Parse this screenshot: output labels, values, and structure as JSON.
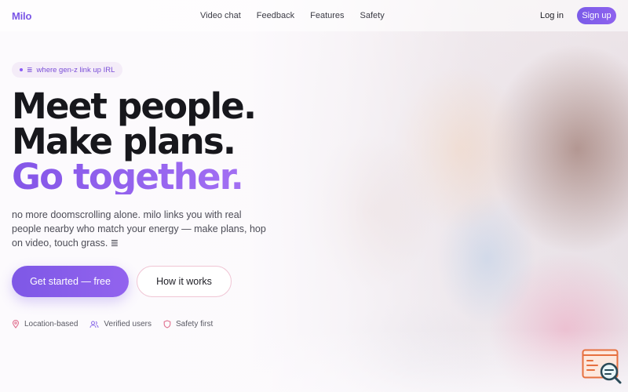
{
  "brand": {
    "logo": "Milo",
    "accent": "#7a56e6"
  },
  "nav": {
    "links": [
      "Video chat",
      "Feedback",
      "Features",
      "Safety"
    ],
    "login": "Log in",
    "signup": "Sign up"
  },
  "hero": {
    "tag_glyph": "≣",
    "tag_text": "where gen-z link up IRL",
    "headline_line1": "Meet people. Make plans.",
    "headline_accent": "Go together.",
    "subcopy": "no more doomscrolling alone. milo links you with real people nearby who match your energy — make plans, hop on video, touch grass. ≣",
    "cta_primary": "Get started — free",
    "cta_secondary": "How it works"
  },
  "trust": [
    {
      "icon": "location-pin-icon",
      "label": "Location-based"
    },
    {
      "icon": "users-icon",
      "label": "Verified users"
    },
    {
      "icon": "shield-icon",
      "label": "Safety first"
    }
  ],
  "colors": {
    "primary": "#7e58e6",
    "secondary_border": "#f0c5d4",
    "icon_pink": "#e0708f"
  }
}
